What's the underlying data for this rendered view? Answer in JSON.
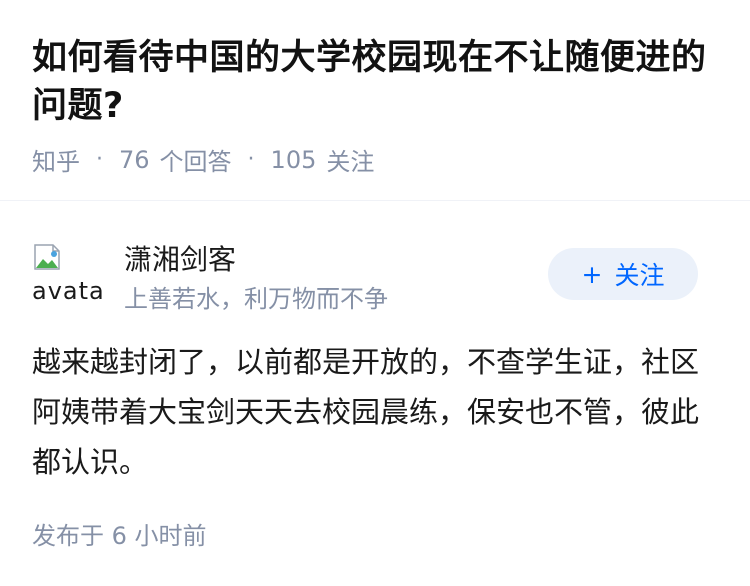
{
  "question": {
    "title": "如何看待中国的大学校园现在不让随便进的问题?",
    "source": "知乎",
    "answers_count": "76",
    "answers_label": "个回答",
    "followers_count": "105",
    "followers_label": "关注"
  },
  "answer": {
    "author": {
      "name": "潇湘剑客",
      "bio": "上善若水，利万物而不争",
      "avatar_alt": "avatar"
    },
    "follow_button": {
      "icon": "+",
      "label": "关注"
    },
    "content": "越来越封闭了，以前都是开放的，不查学生证，社区阿姨带着大宝剑天天去校园晨练，保安也不管，彼此都认识。",
    "published": "发布于 6 小时前"
  },
  "colors": {
    "primary": "#0066ff",
    "muted": "#8590a6",
    "button_bg": "#ebf1fa",
    "text": "#1a1a1a"
  }
}
